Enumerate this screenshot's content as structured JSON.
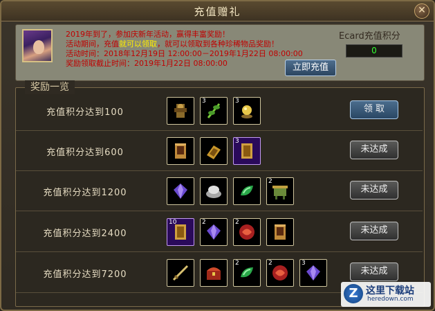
{
  "window": {
    "title": "充值赠礼",
    "close_label": "✕"
  },
  "info": {
    "line1": "2019年到了，参加庆新年活动，赢得丰富奖励！",
    "line2_prefix": "活动期间，充值",
    "line2_highlight": "就可以领取",
    "line2_suffix": "，就可以领取到各种珍稀物品奖励！",
    "line3": "活动时间：2018年12月19日 12:00:00－2019年1月22日 08:00:00",
    "line4": "奖励领取截止时间：2019年1月22日 08:00:00",
    "ecard_label": "Ecard充值积分",
    "ecard_value": "0",
    "recharge_button": "立即充值"
  },
  "list": {
    "title": "奖励一览",
    "rows": [
      {
        "label": "充值积分达到100",
        "button": "领 取",
        "items": [
          {
            "name": "armor-item",
            "count": "",
            "purple": false
          },
          {
            "name": "herb-item",
            "count": "3",
            "purple": false
          },
          {
            "name": "orb-item",
            "count": "3",
            "purple": false
          }
        ]
      },
      {
        "label": "充值积分达到600",
        "button": "未达成",
        "items": [
          {
            "name": "scroll-item",
            "count": "",
            "purple": false
          },
          {
            "name": "book-item",
            "count": "",
            "purple": false
          },
          {
            "name": "tome-item",
            "count": "3",
            "purple": true
          }
        ]
      },
      {
        "label": "充值积分达到1200",
        "button": "未达成",
        "items": [
          {
            "name": "gem-item",
            "count": "",
            "purple": false
          },
          {
            "name": "silver-ingot-item",
            "count": "",
            "purple": false
          },
          {
            "name": "jade-item",
            "count": "",
            "purple": false
          },
          {
            "name": "cauldron-item",
            "count": "2",
            "purple": false
          }
        ]
      },
      {
        "label": "充值积分达到2400",
        "button": "未达成",
        "items": [
          {
            "name": "tome-item",
            "count": "10",
            "purple": true
          },
          {
            "name": "gem-item",
            "count": "2",
            "purple": false
          },
          {
            "name": "red-orb-item",
            "count": "2",
            "purple": false
          },
          {
            "name": "scroll-item",
            "count": "",
            "purple": false
          }
        ]
      },
      {
        "label": "充值积分达到7200",
        "button": "未达成",
        "items": [
          {
            "name": "sword-item",
            "count": "",
            "purple": false
          },
          {
            "name": "chest-item",
            "count": "",
            "purple": false
          },
          {
            "name": "jade-item",
            "count": "2",
            "purple": false
          },
          {
            "name": "red-orb-item",
            "count": "2",
            "purple": false
          },
          {
            "name": "gem-item",
            "count": "3",
            "purple": false
          }
        ]
      }
    ]
  },
  "watermark": {
    "name": "这里下载站",
    "url": "heredown.com",
    "logo": "Z"
  }
}
